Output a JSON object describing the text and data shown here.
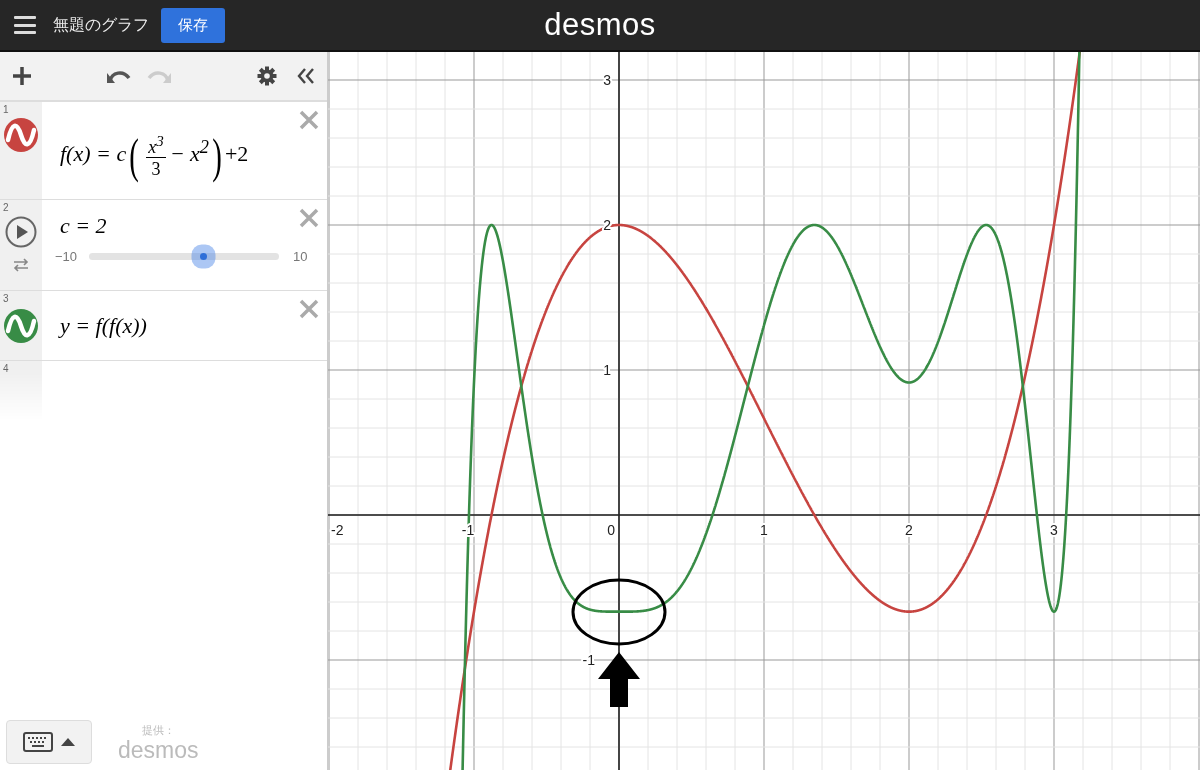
{
  "header": {
    "title": "無題のグラフ",
    "save_button": "保存",
    "logo": "desmos"
  },
  "toolbar": {
    "undo": {
      "disabled": false
    },
    "redo": {
      "disabled": true
    }
  },
  "expressions": [
    {
      "number": "1",
      "kind": "function",
      "color": "#c74440",
      "prefix": "f(x) = c",
      "open": "(",
      "numerator": "x$^{3}$",
      "denominator": "3",
      "suffix": "− x$^{2}$",
      "close": ")",
      "tail": "+2"
    },
    {
      "number": "2",
      "kind": "slider",
      "text": "c = 2",
      "min": "−10",
      "max": "10",
      "level": 0.6
    },
    {
      "number": "3",
      "kind": "equation",
      "color": "#388c46",
      "text": "y = f(f(x))"
    },
    {
      "number": "4",
      "kind": "empty"
    }
  ],
  "graph": {
    "x_labels": [
      "-2",
      "-1",
      "0",
      "1",
      "2",
      "3"
    ],
    "y_labels": [
      "3",
      "2",
      "1",
      "-1"
    ]
  },
  "footer": {
    "credit": "提供：",
    "logo": "desmos"
  }
}
